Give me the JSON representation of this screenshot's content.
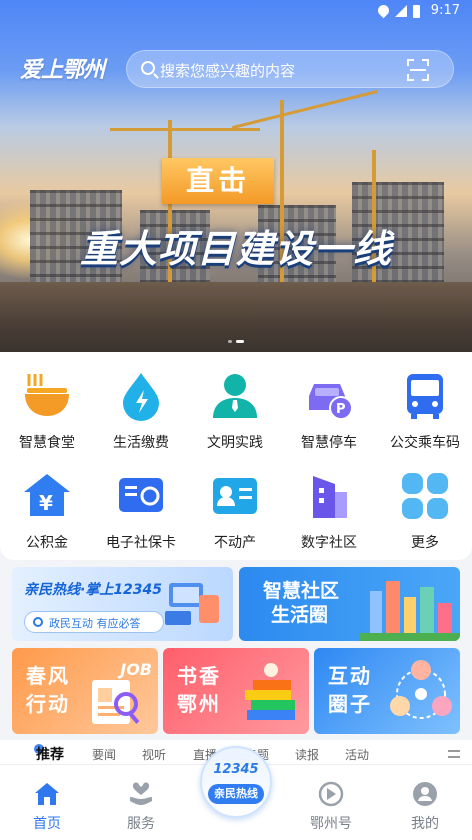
{
  "status_bar": {
    "time": "9:17"
  },
  "header": {
    "logo": "爱上鄂州",
    "search_placeholder": "搜索您感兴趣的内容"
  },
  "banner": {
    "tag": "直击",
    "title": "重大项目建设一线",
    "page_count": 2,
    "active_page": 2
  },
  "services": [
    {
      "label": "智慧食堂",
      "icon": "food-bowl-icon"
    },
    {
      "label": "生活缴费",
      "icon": "water-drop-icon"
    },
    {
      "label": "文明实践",
      "icon": "person-icon"
    },
    {
      "label": "智慧停车",
      "icon": "car-parking-icon"
    },
    {
      "label": "公交乘车码",
      "icon": "bus-icon"
    },
    {
      "label": "公积金",
      "icon": "house-yuan-icon"
    },
    {
      "label": "电子社保卡",
      "icon": "social-card-icon"
    },
    {
      "label": "不动产",
      "icon": "id-card-icon"
    },
    {
      "label": "数字社区",
      "icon": "buildings-icon"
    },
    {
      "label": "更多",
      "icon": "grid-more-icon"
    }
  ],
  "promos": {
    "hotline": {
      "title": "亲民热线·掌上12345",
      "pill": "政民互动 有应必答"
    },
    "community": {
      "line1": "智慧社区",
      "line2": "生活圈"
    },
    "spring": {
      "line1": "春风",
      "line2": "行动",
      "badge": "JOB"
    },
    "books": {
      "line1": "书香",
      "line2": "鄂州"
    },
    "circle": {
      "line1": "互动",
      "line2": "圈子"
    }
  },
  "tabs": [
    "推荐",
    "要闻",
    "视听",
    "直播",
    "专题",
    "读报",
    "活动"
  ],
  "nav": {
    "items": [
      {
        "label": "首页",
        "active": true
      },
      {
        "label": "服务",
        "active": false
      },
      {
        "label": "鄂州号",
        "active": false
      },
      {
        "label": "我的",
        "active": false
      }
    ],
    "fab_number": "12345",
    "fab_label": "亲民热线"
  },
  "colors": {
    "accent": "#2f78ef",
    "tag_orange": "#f39a27"
  }
}
